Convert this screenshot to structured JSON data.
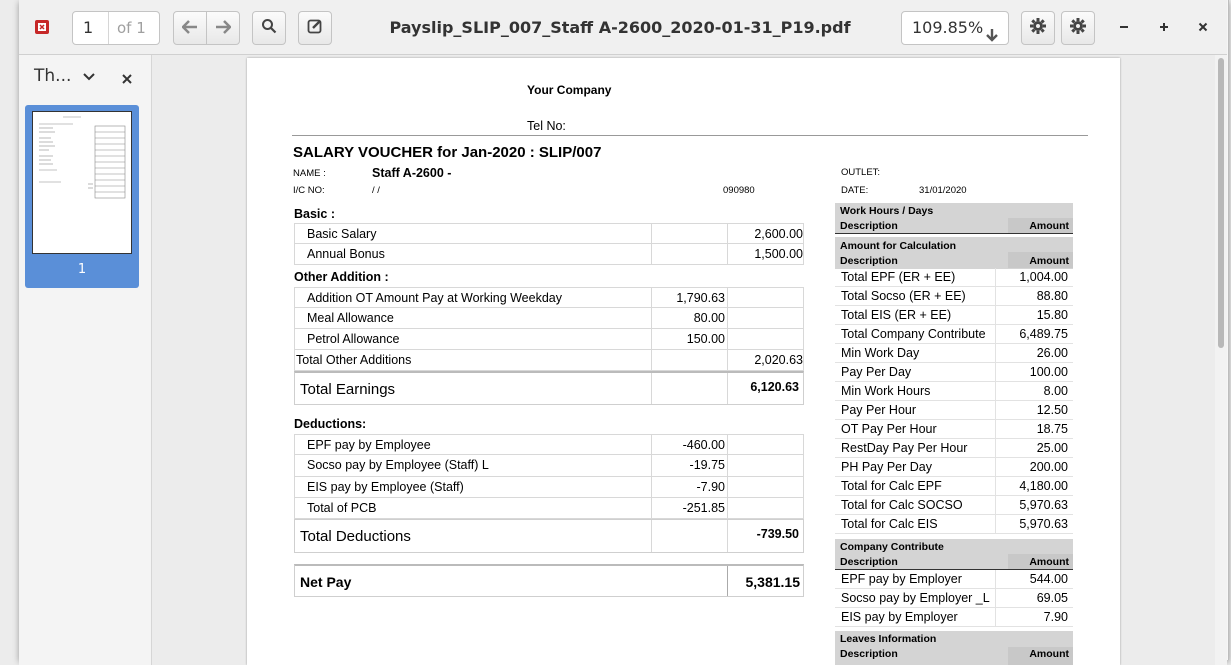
{
  "toolbar": {
    "page_current": "1",
    "page_of": "of 1",
    "title": "Payslip_SLIP_007_Staff A-2600_2020-01-31_P19.pdf",
    "zoom": "109.85%"
  },
  "sidebar": {
    "header": "Th...",
    "thumb_page": "1"
  },
  "doc": {
    "company": "Your Company",
    "tel": "Tel No:",
    "voucher_title": "SALARY VOUCHER for Jan-2020 : SLIP/007",
    "name_label": "NAME :",
    "name_value": "Staff A-2600 -",
    "ic_label": "I/C NO:",
    "ic_value": "/ /",
    "ic_code": "090980",
    "outlet_label": "OUTLET:",
    "date_label": "DATE:",
    "date_value": "31/01/2020",
    "basic_heading": "Basic :",
    "basic_rows": [
      {
        "label": "Basic Salary",
        "c1": "",
        "c2": "2,600.00"
      },
      {
        "label": "Annual Bonus",
        "c1": "",
        "c2": "1,500.00"
      }
    ],
    "other_heading": "Other Addition :",
    "other_rows": [
      {
        "label": "Addition OT Amount Pay at Working Weekday",
        "c1": "1,790.63",
        "c2": ""
      },
      {
        "label": "Meal Allowance",
        "c1": "80.00",
        "c2": ""
      },
      {
        "label": "Petrol Allowance",
        "c1": "150.00",
        "c2": ""
      }
    ],
    "total_other": {
      "label": "Total Other Additions",
      "c2": "2,020.63"
    },
    "total_earnings": {
      "label": "Total Earnings",
      "value": "6,120.63"
    },
    "deductions_heading": "Deductions:",
    "deduction_rows": [
      {
        "label": "EPF pay by Employee",
        "c1": "-460.00",
        "c2": ""
      },
      {
        "label": "Socso pay by Employee (Staff) L",
        "c1": "-19.75",
        "c2": ""
      },
      {
        "label": "EIS pay by Employee (Staff)",
        "c1": "-7.90",
        "c2": ""
      },
      {
        "label": "Total of PCB",
        "c1": "-251.85",
        "c2": ""
      }
    ],
    "total_deductions": {
      "label": "Total Deductions",
      "value": "-739.50"
    },
    "net_pay": {
      "label": "Net Pay",
      "value": "5,381.15"
    },
    "work_hours": {
      "title": "Work Hours / Days",
      "desc": "Description",
      "amount": "Amount"
    },
    "calc": {
      "title": "Amount for Calculation",
      "desc": "Description",
      "amount": "Amount",
      "rows": [
        {
          "label": "Total EPF (ER + EE)",
          "value": "1,004.00"
        },
        {
          "label": "Total Socso (ER + EE)",
          "value": "88.80"
        },
        {
          "label": "Total EIS (ER + EE)",
          "value": "15.80"
        },
        {
          "label": "Total Company Contribute",
          "value": "6,489.75"
        },
        {
          "label": "Min Work Day",
          "value": "26.00"
        },
        {
          "label": "Pay Per Day",
          "value": "100.00"
        },
        {
          "label": "Min Work Hours",
          "value": "8.00"
        },
        {
          "label": "Pay Per Hour",
          "value": "12.50"
        },
        {
          "label": "OT Pay Per Hour",
          "value": "18.75"
        },
        {
          "label": "RestDay Pay Per Hour",
          "value": "25.00"
        },
        {
          "label": "PH Pay Per Day",
          "value": "200.00"
        },
        {
          "label": "Total for Calc EPF",
          "value": "4,180.00"
        },
        {
          "label": "Total for Calc SOCSO",
          "value": "5,970.63"
        },
        {
          "label": "Total for Calc EIS",
          "value": "5,970.63"
        }
      ]
    },
    "company_contribute": {
      "title": "Company Contribute",
      "desc": "Description",
      "amount": "Amount",
      "rows": [
        {
          "label": "EPF pay by Employer",
          "value": "544.00"
        },
        {
          "label": "Socso pay by Employer _L",
          "value": "69.05"
        },
        {
          "label": "EIS pay by Employer",
          "value": "7.90"
        }
      ]
    },
    "leaves": {
      "title": "Leaves Information",
      "desc": "Description",
      "amount": "Amount"
    }
  }
}
